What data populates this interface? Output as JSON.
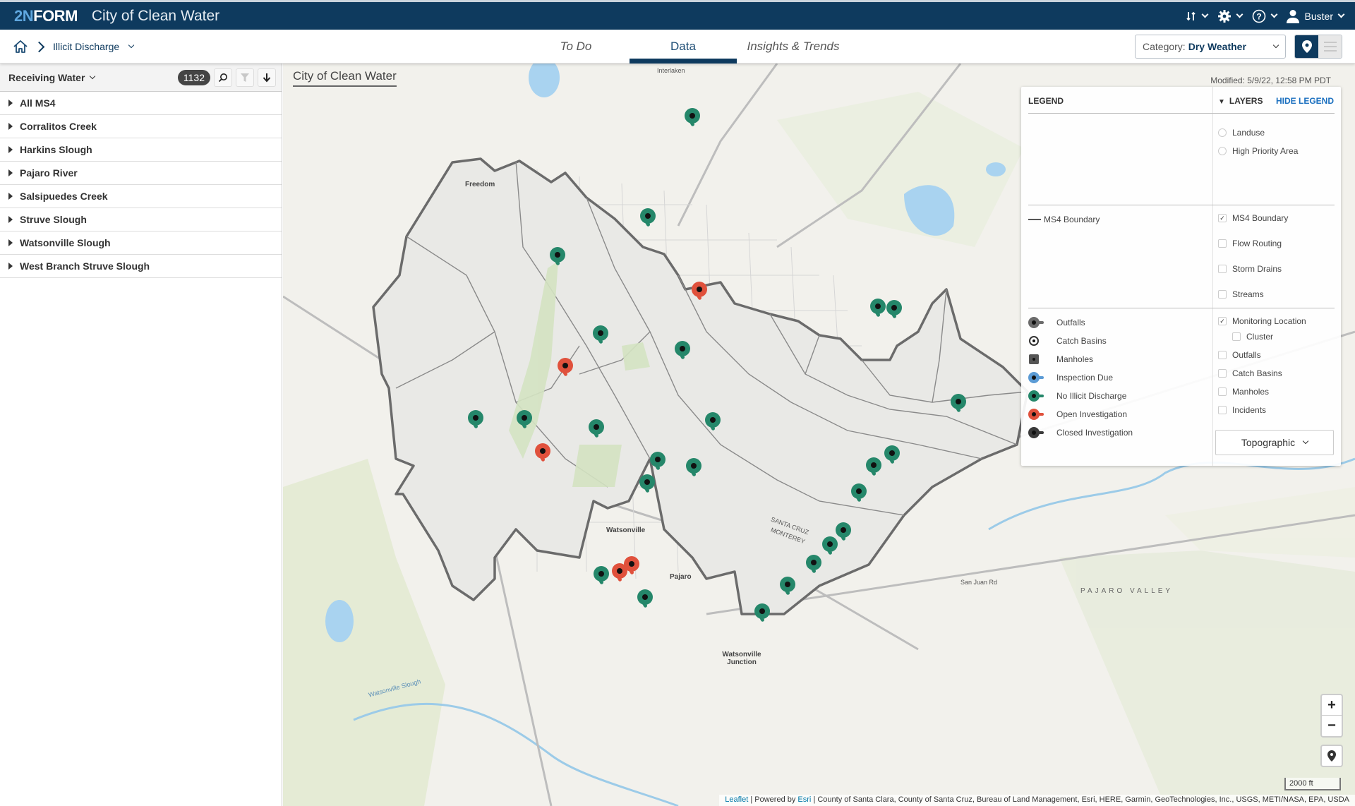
{
  "header": {
    "logo_prefix": "2N",
    "logo_suffix": "FORM",
    "app_title": "City of Clean Water",
    "user_name": "Buster",
    "icons": [
      "sort-icon",
      "gear-icon",
      "help-icon",
      "user-icon"
    ]
  },
  "breadcrumb": {
    "home_icon": "home-icon",
    "current": "Illicit Discharge"
  },
  "tabs": [
    {
      "label": "To Do",
      "active": false
    },
    {
      "label": "Data",
      "active": true
    },
    {
      "label": "Insights & Trends",
      "active": false
    }
  ],
  "category": {
    "prefix": "Category:",
    "value": "Dry Weather"
  },
  "view_toggle": {
    "active": "map",
    "options": [
      "map",
      "list"
    ]
  },
  "sidebar": {
    "title": "Receiving Water",
    "count": "1132",
    "items": [
      {
        "label": "All MS4"
      },
      {
        "label": "Corralitos Creek"
      },
      {
        "label": "Harkins Slough"
      },
      {
        "label": "Pajaro River"
      },
      {
        "label": "Salsipuedes Creek"
      },
      {
        "label": "Struve Slough"
      },
      {
        "label": "Watsonville Slough"
      },
      {
        "label": "West Branch Struve Slough"
      }
    ]
  },
  "map": {
    "title": "City of Clean Water",
    "modified": "Modified: 5/9/22, 12:58 PM PDT",
    "labels": {
      "freedom": "Freedom",
      "watsonville": "Watsonville",
      "pajaro": "Pajaro",
      "watsonville_junction": "Watsonville Junction",
      "pajaro_valley": "PAJARO VALLEY",
      "santa_cruz": "SANTA CRUZ",
      "monterey": "MONTEREY",
      "interlaken": "Interlaken",
      "san_juan_rd": "San Juan Rd",
      "watsonville_slough": "Watsonville Slough"
    },
    "scale": "2000 ft",
    "zoom_in": "+",
    "zoom_out": "−",
    "attribution": {
      "leaflet": "Leaflet",
      "powered_by": "Powered by",
      "esri": "Esri",
      "sources": "County of Santa Clara, County of Santa Cruz, Bureau of Land Management, Esri, HERE, Garmin, GeoTechnologies, Inc., USGS, METI/NASA, EPA, USDA"
    },
    "marker_colors": {
      "no_illicit": "#25876a",
      "open": "#e0513c"
    }
  },
  "legend": {
    "title": "LEGEND",
    "layers_title": "LAYERS",
    "hide_label": "HIDE LEGEND",
    "boundary_label": "MS4 Boundary",
    "symbols": [
      {
        "label": "Outfalls",
        "color": "#6b6b6b",
        "shape": "pin"
      },
      {
        "label": "Catch Basins",
        "color": "#333333",
        "shape": "ring"
      },
      {
        "label": "Manholes",
        "color": "#555555",
        "shape": "square"
      },
      {
        "label": "Inspection Due",
        "color": "#5b9bd5",
        "shape": "pin"
      },
      {
        "label": "No Illicit Discharge",
        "color": "#25876a",
        "shape": "pin"
      },
      {
        "label": "Open Investigation",
        "color": "#e0513c",
        "shape": "pin"
      },
      {
        "label": "Closed Investigation",
        "color": "#3a3a3a",
        "shape": "pin"
      }
    ],
    "layers": [
      {
        "label": "Landuse",
        "type": "radio",
        "checked": false
      },
      {
        "label": "High Priority Area",
        "type": "radio",
        "checked": false
      },
      {
        "label": "MS4 Boundary",
        "type": "checkbox",
        "checked": true
      },
      {
        "label": "Flow Routing",
        "type": "checkbox",
        "checked": false
      },
      {
        "label": "Storm Drains",
        "type": "checkbox",
        "checked": false
      },
      {
        "label": "Streams",
        "type": "checkbox",
        "checked": false
      },
      {
        "label": "Monitoring Location",
        "type": "checkbox",
        "checked": true
      },
      {
        "label": "Cluster",
        "type": "checkbox",
        "checked": false
      },
      {
        "label": "Outfalls",
        "type": "checkbox",
        "checked": false
      },
      {
        "label": "Catch Basins",
        "type": "checkbox",
        "checked": false
      },
      {
        "label": "Manholes",
        "type": "checkbox",
        "checked": false
      },
      {
        "label": "Incidents",
        "type": "checkbox",
        "checked": false
      }
    ],
    "basemap": "Topographic"
  }
}
